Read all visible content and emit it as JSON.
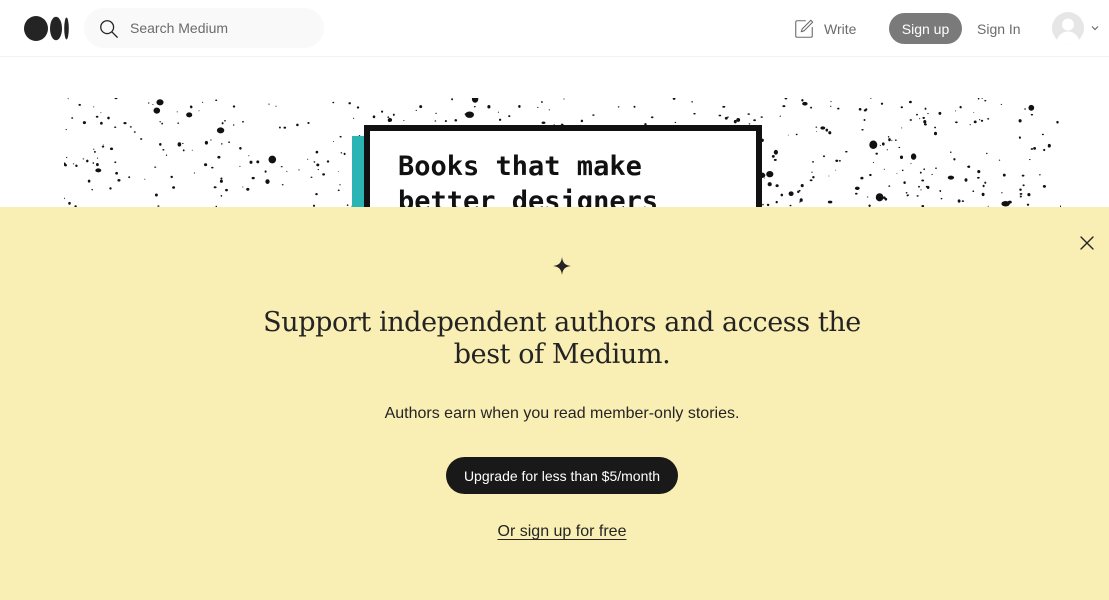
{
  "header": {
    "logo": "medium-logo",
    "search": {
      "placeholder": "Search Medium",
      "value": "",
      "icon": "search-icon"
    },
    "write": {
      "label": "Write",
      "icon": "pencil-square-icon"
    },
    "signup_label": "Sign up",
    "signin_label": "Sign In",
    "avatar": {
      "icon": "user-avatar-icon",
      "menu_icon": "chevron-down-icon"
    }
  },
  "hero": {
    "book_title": "Books that make better designers",
    "accent_color": "#2bb4b4"
  },
  "paywall": {
    "close_icon": "close-icon",
    "sparkle_icon": "sparkle-icon",
    "headline": "Support independent authors and access the best of Medium.",
    "subtext": "Authors earn when you read member-only stories.",
    "upgrade_label": "Upgrade for less than $5/month",
    "signup_free_label": "Or sign up for free",
    "background_color": "#f9eeb3"
  },
  "colors": {
    "primary_text": "#242424",
    "muted_text": "#6b6b6b",
    "signup_button": "#7a7a7a",
    "cta_button": "#191919"
  }
}
